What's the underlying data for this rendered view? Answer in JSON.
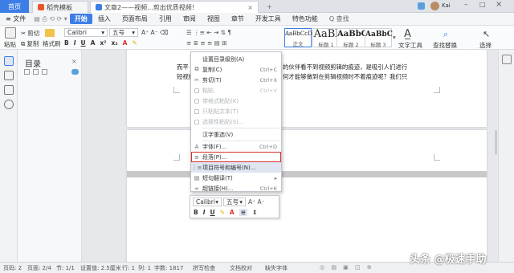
{
  "tabs": {
    "home": "首页",
    "t2": "稻壳模板",
    "t3": "文章2——视频...剪出优质视频！"
  },
  "window": {
    "user": "Kai"
  },
  "menu": [
    "≡ 文件",
    "开始",
    "插入",
    "页面布局",
    "引用",
    "审阅",
    "视图",
    "章节",
    "开发工具",
    "特色功能"
  ],
  "menu_search": "Q 查找",
  "ribbon": {
    "paste": "粘贴",
    "cut": "剪切",
    "copy": "复制",
    "format_painter": "格式刷",
    "font": "Calibri",
    "size": "五号",
    "styles": [
      {
        "big": "AaBbCcDd",
        "label": "正文"
      },
      {
        "big": "AaBl",
        "label": "标题 1"
      },
      {
        "big": "AaBbC",
        "label": "标题 2"
      },
      {
        "big": "AaBbC",
        "label": "标题 3"
      }
    ],
    "text_tools": "文字工具",
    "find_replace": "查找替换",
    "select": "选择"
  },
  "outline": {
    "title": "目录"
  },
  "doc": {
    "line1a": "而平",
    "line1b": "的伙伴看不到视频剪辑的痕迹，是吸引人们进行",
    "line2a": "短视频",
    "line2b": "何才能够做到在剪辑视频时不着痕迹呢？我们只"
  },
  "context_menu": [
    {
      "icon": "",
      "label": "设置目录级别(A)",
      "shortcut": "",
      "state": "normal"
    },
    {
      "icon": "⧉",
      "label": "复制(C)",
      "shortcut": "Ctrl+C",
      "state": "normal"
    },
    {
      "icon": "✂",
      "label": "剪切(T)",
      "shortcut": "Ctrl+X",
      "state": "normal"
    },
    {
      "icon": "▢",
      "label": "粘贴",
      "shortcut": "Ctrl+V",
      "state": "disabled"
    },
    {
      "icon": "▢",
      "label": "带格式粘贴(K)",
      "shortcut": "",
      "state": "disabled"
    },
    {
      "icon": "▢",
      "label": "只粘贴文本(T)",
      "shortcut": "",
      "state": "disabled"
    },
    {
      "icon": "▢",
      "label": "选择性粘贴(S)...",
      "shortcut": "",
      "state": "disabled"
    },
    {
      "icon": "",
      "label": "汉字重选(V)",
      "shortcut": "",
      "state": "normal"
    },
    {
      "icon": "A",
      "label": "字体(F)...",
      "shortcut": "Ctrl+D",
      "state": "normal"
    },
    {
      "icon": "≡",
      "label": "段落(P)...",
      "shortcut": "",
      "state": "highlighted"
    },
    {
      "icon": "⋮≡",
      "label": "项目符号和编号(N)...",
      "shortcut": "",
      "state": "hover"
    },
    {
      "icon": "▤",
      "label": "短句翻译(T)",
      "shortcut": "▸",
      "state": "normal"
    },
    {
      "icon": "∞",
      "label": "超链接(H)...",
      "shortcut": "Ctrl+K",
      "state": "normal"
    }
  ],
  "mini_toolbar": {
    "font": "Calibri",
    "size": "五号",
    "bold": "B",
    "italic": "I",
    "underline": "U"
  },
  "status": {
    "page": "页码: 2",
    "pages": "页面: 2/4",
    "section": "节: 1/1",
    "setting": "设置值: 2.5厘米",
    "row": "行: 1",
    "col": "列: 1",
    "words": "字数: 1817",
    "spell": "拼写检查",
    "proof": "文档校对",
    "missing_font": "缺失字体"
  },
  "watermark": "头条 @极速手助",
  "colors": {
    "accent": "#3d7de6",
    "highlight_box": "#d9302c"
  }
}
